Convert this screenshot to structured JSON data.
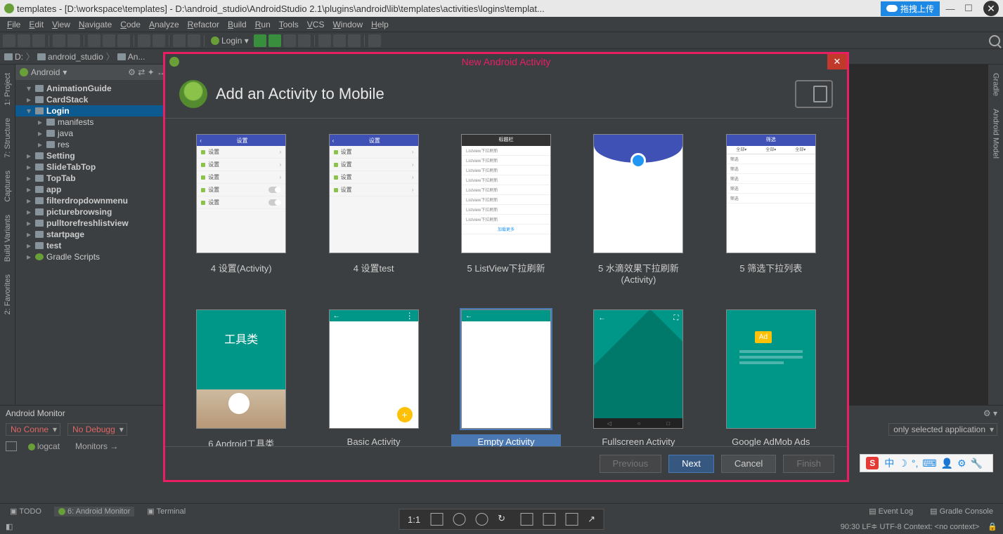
{
  "titlebar": {
    "text": "templates - [D:\\workspace\\templates] - D:\\android_studio\\AndroidStudio 2.1\\plugins\\android\\lib\\templates\\activities\\logins\\templat...",
    "upload": "拖拽上传",
    "minimize": "—",
    "maximize": "☐",
    "close": "✕"
  },
  "menubar": [
    "File",
    "Edit",
    "View",
    "Navigate",
    "Code",
    "Analyze",
    "Refactor",
    "Build",
    "Run",
    "Tools",
    "VCS",
    "Window",
    "Help"
  ],
  "run_config": "Login ▾",
  "breadcrumb": [
    {
      "icon": true,
      "text": "D:"
    },
    {
      "icon": true,
      "text": "android_studio"
    },
    {
      "icon": true,
      "text": "An..."
    }
  ],
  "left_tabs": [
    "1: Project",
    "7: Structure",
    "Captures",
    "Build Variants",
    "2: Favorites"
  ],
  "right_tabs": [
    "Gradle",
    "Android Model"
  ],
  "project": {
    "header": "Android",
    "tree": [
      {
        "d": 1,
        "arrow": "▾",
        "ic": "pkg",
        "label": "AnimationGuide",
        "bold": true
      },
      {
        "d": 1,
        "arrow": "▸",
        "ic": "pkg",
        "label": "CardStack",
        "bold": true
      },
      {
        "d": 1,
        "arrow": "▾",
        "ic": "pkg",
        "label": "Login",
        "bold": true,
        "sel": true
      },
      {
        "d": 2,
        "arrow": "▸",
        "ic": "pkg",
        "label": "manifests"
      },
      {
        "d": 2,
        "arrow": "▸",
        "ic": "pkg",
        "label": "java"
      },
      {
        "d": 2,
        "arrow": "▸",
        "ic": "pkg",
        "label": "res"
      },
      {
        "d": 1,
        "arrow": "▸",
        "ic": "pkg",
        "label": "Setting",
        "bold": true
      },
      {
        "d": 1,
        "arrow": "▸",
        "ic": "pkg",
        "label": "SlideTabTop",
        "bold": true
      },
      {
        "d": 1,
        "arrow": "▸",
        "ic": "pkg",
        "label": "TopTab",
        "bold": true
      },
      {
        "d": 1,
        "arrow": "▸",
        "ic": "pkg",
        "label": "app",
        "bold": true
      },
      {
        "d": 1,
        "arrow": "▸",
        "ic": "pkg",
        "label": "filterdropdownmenu",
        "bold": true
      },
      {
        "d": 1,
        "arrow": "▸",
        "ic": "pkg",
        "label": "picturebrowsing",
        "bold": true
      },
      {
        "d": 1,
        "arrow": "▸",
        "ic": "pkg",
        "label": "pulltorefreshlistview",
        "bold": true
      },
      {
        "d": 1,
        "arrow": "▸",
        "ic": "pkg",
        "label": "startpage",
        "bold": true
      },
      {
        "d": 1,
        "arrow": "▸",
        "ic": "pkg",
        "label": "test",
        "bold": true
      },
      {
        "d": 1,
        "arrow": "▸",
        "ic": "gradle",
        "label": "Gradle Scripts",
        "bold": false
      }
    ]
  },
  "bottom": {
    "title": "Android Monitor",
    "dropdown1": "No Conne",
    "dropdown2": "No Debugg",
    "logcat": "logcat",
    "monitors": "Monitors →",
    "right_drop": "only selected application"
  },
  "footer": {
    "todo": "TODO",
    "android_monitor": "6: Android Monitor",
    "terminal": "Terminal",
    "event_log": "Event Log",
    "gradle_console": "Gradle Console",
    "status": "90:30  LF≑  UTF-8  Context: <no context>"
  },
  "dialog": {
    "title": "New Android Activity",
    "heading": "Add an Activity to Mobile",
    "templates": [
      {
        "label": "4 设置(Activity)",
        "kind": "settings"
      },
      {
        "label": "4 设置test",
        "kind": "settings2"
      },
      {
        "label": "5 ListView下拉刷新",
        "kind": "listview"
      },
      {
        "label": "5 水滴效果下拉刷新(Activity)",
        "kind": "drop"
      },
      {
        "label": "5 筛选下拉列表",
        "kind": "filter"
      },
      {
        "label": "6 Android工具类",
        "kind": "toolkit"
      },
      {
        "label": "Basic Activity",
        "kind": "basic"
      },
      {
        "label": "Empty Activity",
        "kind": "empty",
        "selected": true
      },
      {
        "label": "Fullscreen Activity",
        "kind": "fullscreen"
      },
      {
        "label": "Google AdMob Ads Activity",
        "kind": "admob"
      }
    ],
    "buttons": {
      "previous": "Previous",
      "next": "Next",
      "cancel": "Cancel",
      "finish": "Finish"
    }
  },
  "viewer": {
    "ratio": "1:1"
  },
  "ime": {
    "s": "S",
    "glyphs": [
      "中",
      "☽",
      "°,",
      "⌨",
      "👤",
      "⚙",
      "🔧"
    ]
  }
}
